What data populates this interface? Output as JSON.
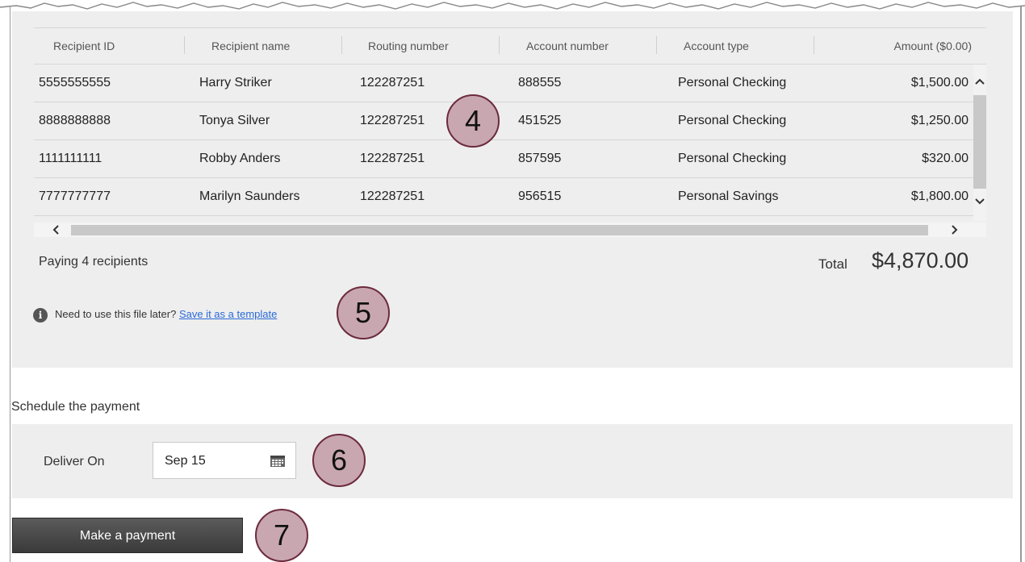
{
  "table": {
    "headers": [
      "Recipient ID",
      "Recipient name",
      "Routing number",
      "Account number",
      "Account type",
      "Amount ($0.00)"
    ],
    "rows": [
      {
        "id": "5555555555",
        "name": "Harry Striker",
        "routing": "122287251",
        "account": "888555",
        "type": "Personal Checking",
        "amount": "$1,500.00"
      },
      {
        "id": "8888888888",
        "name": "Tonya Silver",
        "routing": "122287251",
        "account": "451525",
        "type": "Personal Checking",
        "amount": "$1,250.00"
      },
      {
        "id": "1111111111",
        "name": "Robby Anders",
        "routing": "122287251",
        "account": "857595",
        "type": "Personal Checking",
        "amount": "$320.00"
      },
      {
        "id": "7777777777",
        "name": "Marilyn Saunders",
        "routing": "122287251",
        "account": "956515",
        "type": "Personal Savings",
        "amount": "$1,800.00"
      }
    ]
  },
  "summary": {
    "paying_text": "Paying 4 recipients",
    "total_label": "Total",
    "total_value": "$4,870.00"
  },
  "template_notice": {
    "info_glyph": "i",
    "text": "Need to use this file later?",
    "link": "Save it as a template"
  },
  "schedule": {
    "title": "Schedule the payment",
    "deliver_label": "Deliver On",
    "date_value": "Sep 15"
  },
  "actions": {
    "make_payment": "Make a payment"
  },
  "callouts": [
    "4",
    "5",
    "6",
    "7"
  ],
  "icons": {
    "calendar": "calendar-icon",
    "info": "info-icon",
    "scroll_up": "chevron-up-icon",
    "scroll_down": "chevron-down-icon",
    "scroll_left": "chevron-left-icon",
    "scroll_right": "chevron-right-icon"
  },
  "colors": {
    "panel_bg": "#eeeeee",
    "link": "#2a6ad8",
    "button_bg": "#4a4a4a",
    "callout_fill": "#c9a7b0",
    "callout_border": "#6b2b3d"
  }
}
